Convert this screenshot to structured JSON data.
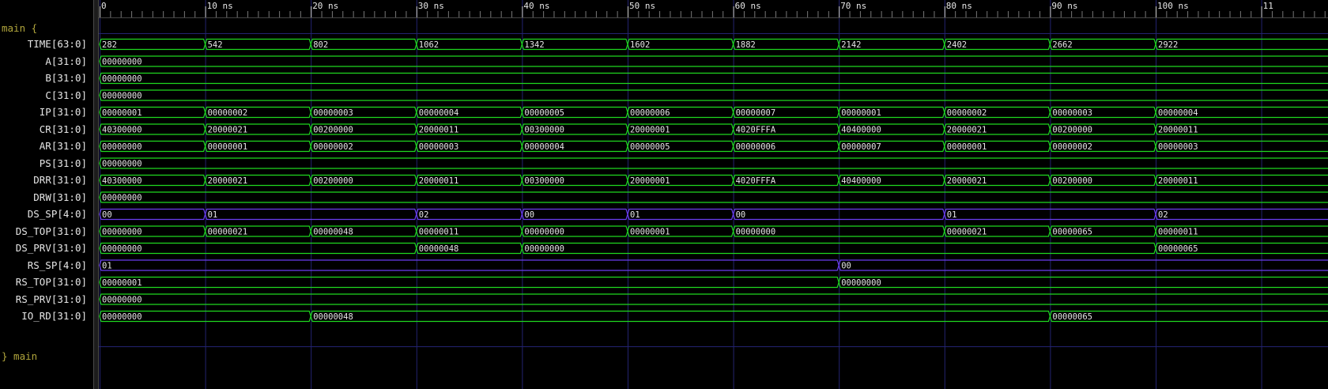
{
  "timeline": {
    "unit": "ns",
    "ticks": [
      {
        "t": 0,
        "label": "0"
      },
      {
        "t": 10,
        "label": "10 ns"
      },
      {
        "t": 20,
        "label": "20 ns"
      },
      {
        "t": 30,
        "label": "30 ns"
      },
      {
        "t": 40,
        "label": "40 ns"
      },
      {
        "t": 50,
        "label": "50 ns"
      },
      {
        "t": 60,
        "label": "60 ns"
      },
      {
        "t": 70,
        "label": "70 ns"
      },
      {
        "t": 80,
        "label": "80 ns"
      },
      {
        "t": 90,
        "label": "90 ns"
      },
      {
        "t": 100,
        "label": "100 ns"
      },
      {
        "t": 110,
        "label": "11"
      }
    ]
  },
  "group": {
    "open_label": "main {",
    "close_label": "} main"
  },
  "colors": {
    "wave": "#1fd81f",
    "stack_pointer": "#6a3df0",
    "grid": "#232370",
    "text": "#e6e6e6",
    "group": "#b0a53c"
  },
  "signals": [
    {
      "name": "TIME[63:0]",
      "color": "wave",
      "segments": [
        [
          0,
          "282"
        ],
        [
          10,
          "542"
        ],
        [
          20,
          "802"
        ],
        [
          30,
          "1062"
        ],
        [
          40,
          "1342"
        ],
        [
          50,
          "1602"
        ],
        [
          60,
          "1882"
        ],
        [
          70,
          "2142"
        ],
        [
          80,
          "2402"
        ],
        [
          90,
          "2662"
        ],
        [
          100,
          "2922"
        ]
      ]
    },
    {
      "name": "A[31:0]",
      "color": "wave",
      "segments": [
        [
          0,
          "00000000"
        ]
      ]
    },
    {
      "name": "B[31:0]",
      "color": "wave",
      "segments": [
        [
          0,
          "00000000"
        ]
      ]
    },
    {
      "name": "C[31:0]",
      "color": "wave",
      "segments": [
        [
          0,
          "00000000"
        ]
      ]
    },
    {
      "name": "IP[31:0]",
      "color": "wave",
      "segments": [
        [
          0,
          "00000001"
        ],
        [
          10,
          "00000002"
        ],
        [
          20,
          "00000003"
        ],
        [
          30,
          "00000004"
        ],
        [
          40,
          "00000005"
        ],
        [
          50,
          "00000006"
        ],
        [
          60,
          "00000007"
        ],
        [
          70,
          "00000001"
        ],
        [
          80,
          "00000002"
        ],
        [
          90,
          "00000003"
        ],
        [
          100,
          "00000004"
        ]
      ]
    },
    {
      "name": "CR[31:0]",
      "color": "wave",
      "segments": [
        [
          0,
          "40300000"
        ],
        [
          10,
          "20000021"
        ],
        [
          20,
          "00200000"
        ],
        [
          30,
          "20000011"
        ],
        [
          40,
          "00300000"
        ],
        [
          50,
          "20000001"
        ],
        [
          60,
          "4020FFFA"
        ],
        [
          70,
          "40400000"
        ],
        [
          80,
          "20000021"
        ],
        [
          90,
          "00200000"
        ],
        [
          100,
          "20000011"
        ]
      ]
    },
    {
      "name": "AR[31:0]",
      "color": "wave",
      "segments": [
        [
          0,
          "00000000"
        ],
        [
          10,
          "00000001"
        ],
        [
          20,
          "00000002"
        ],
        [
          30,
          "00000003"
        ],
        [
          40,
          "00000004"
        ],
        [
          50,
          "00000005"
        ],
        [
          60,
          "00000006"
        ],
        [
          70,
          "00000007"
        ],
        [
          80,
          "00000001"
        ],
        [
          90,
          "00000002"
        ],
        [
          100,
          "00000003"
        ]
      ]
    },
    {
      "name": "PS[31:0]",
      "color": "wave",
      "segments": [
        [
          0,
          "00000000"
        ]
      ]
    },
    {
      "name": "DRR[31:0]",
      "color": "wave",
      "segments": [
        [
          0,
          "40300000"
        ],
        [
          10,
          "20000021"
        ],
        [
          20,
          "00200000"
        ],
        [
          30,
          "20000011"
        ],
        [
          40,
          "00300000"
        ],
        [
          50,
          "20000001"
        ],
        [
          60,
          "4020FFFA"
        ],
        [
          70,
          "40400000"
        ],
        [
          80,
          "20000021"
        ],
        [
          90,
          "00200000"
        ],
        [
          100,
          "20000011"
        ]
      ]
    },
    {
      "name": "DRW[31:0]",
      "color": "wave",
      "segments": [
        [
          0,
          "00000000"
        ]
      ]
    },
    {
      "name": "DS_SP[4:0]",
      "color": "stack_pointer",
      "segments": [
        [
          0,
          "00"
        ],
        [
          10,
          "01"
        ],
        [
          30,
          "02"
        ],
        [
          40,
          "00"
        ],
        [
          50,
          "01"
        ],
        [
          60,
          "00"
        ],
        [
          80,
          "01"
        ],
        [
          100,
          "02"
        ]
      ]
    },
    {
      "name": "DS_TOP[31:0]",
      "color": "wave",
      "segments": [
        [
          0,
          "00000000"
        ],
        [
          10,
          "00000021"
        ],
        [
          20,
          "00000048"
        ],
        [
          30,
          "00000011"
        ],
        [
          40,
          "00000000"
        ],
        [
          50,
          "00000001"
        ],
        [
          60,
          "00000000"
        ],
        [
          80,
          "00000021"
        ],
        [
          90,
          "00000065"
        ],
        [
          100,
          "00000011"
        ]
      ]
    },
    {
      "name": "DS_PRV[31:0]",
      "color": "wave",
      "segments": [
        [
          0,
          "00000000"
        ],
        [
          30,
          "00000048"
        ],
        [
          40,
          "00000000"
        ],
        [
          100,
          "00000065"
        ]
      ]
    },
    {
      "name": "RS_SP[4:0]",
      "color": "stack_pointer",
      "segments": [
        [
          0,
          "01"
        ],
        [
          70,
          "00"
        ]
      ]
    },
    {
      "name": "RS_TOP[31:0]",
      "color": "wave",
      "segments": [
        [
          0,
          "00000001"
        ],
        [
          70,
          "00000000"
        ]
      ]
    },
    {
      "name": "RS_PRV[31:0]",
      "color": "wave",
      "segments": [
        [
          0,
          "00000000"
        ]
      ]
    },
    {
      "name": "IO_RD[31:0]",
      "color": "wave",
      "segments": [
        [
          0,
          "00000000"
        ],
        [
          20,
          "00000048"
        ],
        [
          90,
          "00000065"
        ]
      ]
    }
  ]
}
